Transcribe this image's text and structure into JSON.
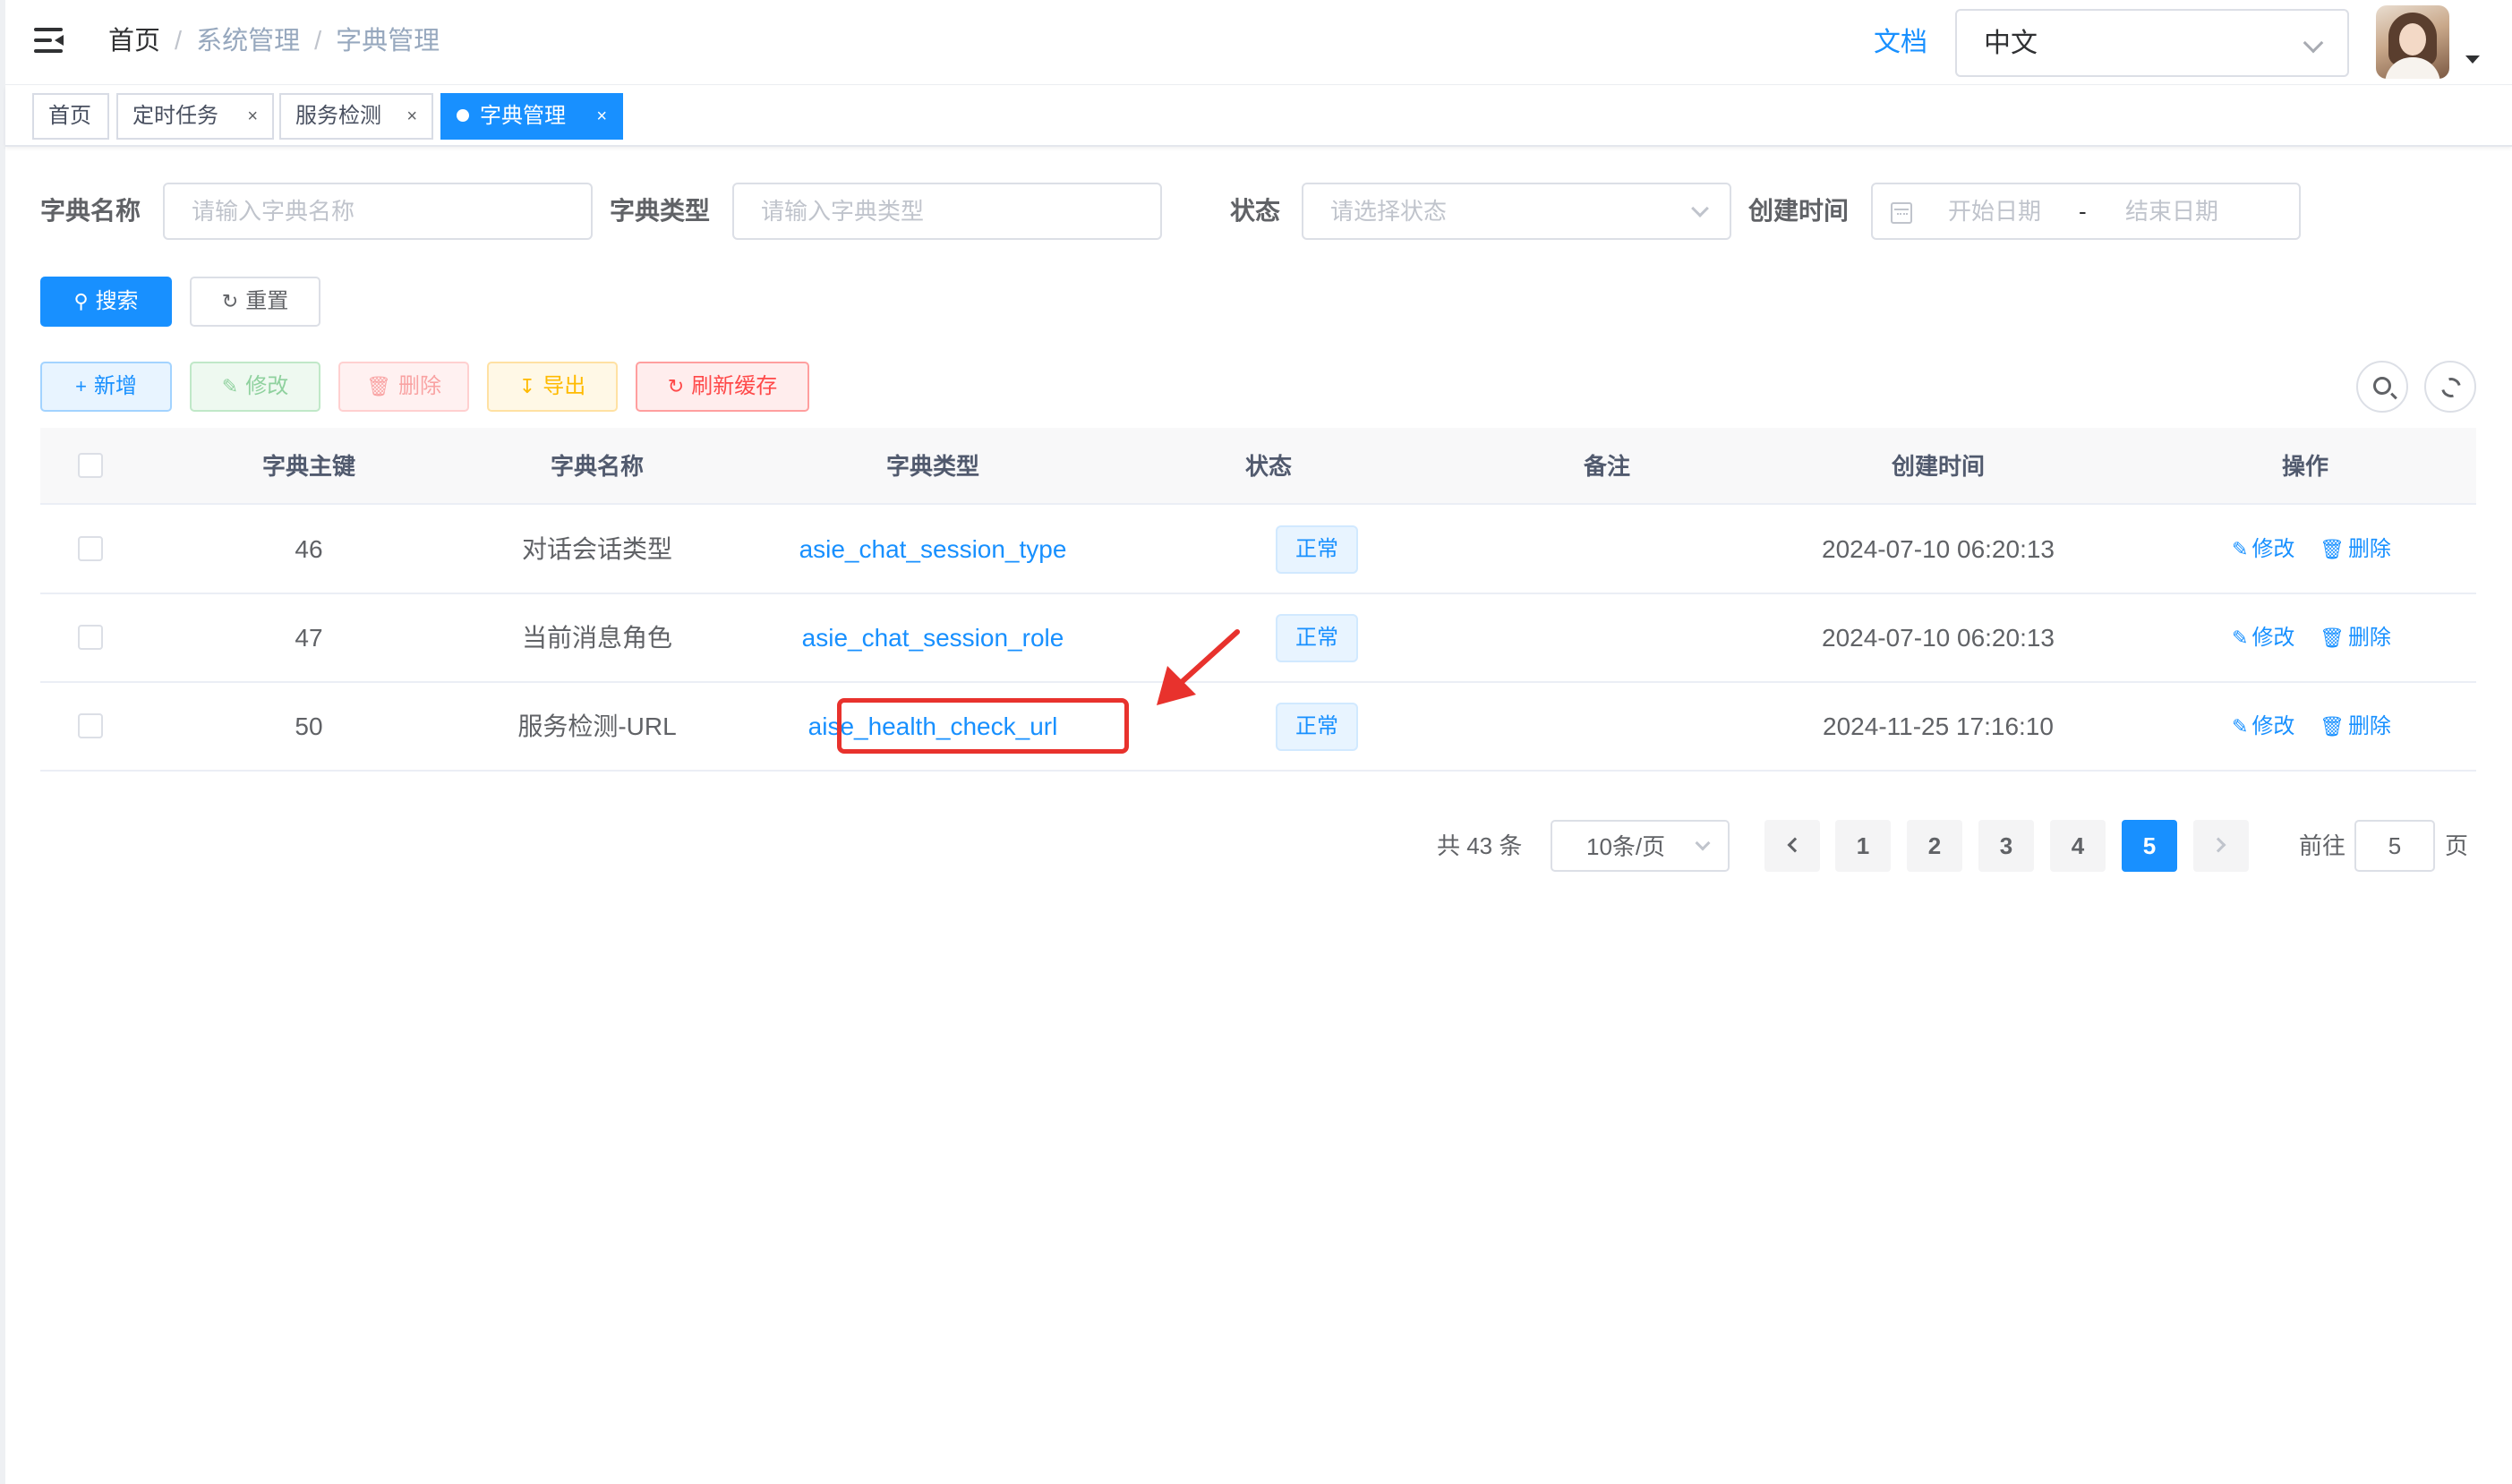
{
  "breadcrumb": [
    "首页",
    "系统管理",
    "字典管理"
  ],
  "navbar": {
    "doc_label": "文档",
    "language": "中文"
  },
  "tags": [
    {
      "label": "首页",
      "closable": false
    },
    {
      "label": "定时任务",
      "closable": true
    },
    {
      "label": "服务检测",
      "closable": true
    },
    {
      "label": "字典管理",
      "closable": true,
      "active": true
    }
  ],
  "tag_close_glyph": "×",
  "search_form": {
    "dict_name_label": "字典名称",
    "dict_name_placeholder": "请输入字典名称",
    "dict_type_label": "字典类型",
    "dict_type_placeholder": "请输入字典类型",
    "status_label": "状态",
    "status_placeholder": "请选择状态",
    "create_time_label": "创建时间",
    "start_date_placeholder": "开始日期",
    "range_separator": "-",
    "end_date_placeholder": "结束日期",
    "search_button": "搜索",
    "reset_button": "重置"
  },
  "toolbar": {
    "add": "新增",
    "edit": "修改",
    "delete": "删除",
    "export": "导出",
    "refresh_cache": "刷新缓存"
  },
  "table": {
    "columns": [
      "字典主键",
      "字典名称",
      "字典类型",
      "状态",
      "备注",
      "创建时间",
      "操作"
    ],
    "rows": [
      {
        "id": "46",
        "name": "对话会话类型",
        "type": "asie_chat_session_type",
        "status": "正常",
        "remark": "",
        "created": "2024-07-10 06:20:13",
        "edit": "修改",
        "delete": "删除"
      },
      {
        "id": "47",
        "name": "当前消息角色",
        "type": "asie_chat_session_role",
        "status": "正常",
        "remark": "",
        "created": "2024-07-10 06:20:13",
        "edit": "修改",
        "delete": "删除"
      },
      {
        "id": "50",
        "name": "服务检测-URL",
        "type": "aise_health_check_url",
        "status": "正常",
        "remark": "",
        "created": "2024-11-25 17:16:10",
        "edit": "修改",
        "delete": "删除"
      }
    ]
  },
  "pagination": {
    "total_text": "共 43 条",
    "page_size": "10条/页",
    "pages": [
      "1",
      "2",
      "3",
      "4",
      "5"
    ],
    "current_page": "5",
    "goto_label": "前往",
    "goto_value": "5",
    "page_suffix": "页"
  },
  "colors": {
    "primary": "#1890ff",
    "annotation_red": "#e8322d"
  },
  "icons": {
    "menu": "hamburger-icon",
    "search": "search-icon",
    "refresh": "refresh-icon",
    "edit": "edit-icon",
    "delete": "delete-icon",
    "export": "download-icon",
    "calendar": "calendar-icon"
  }
}
